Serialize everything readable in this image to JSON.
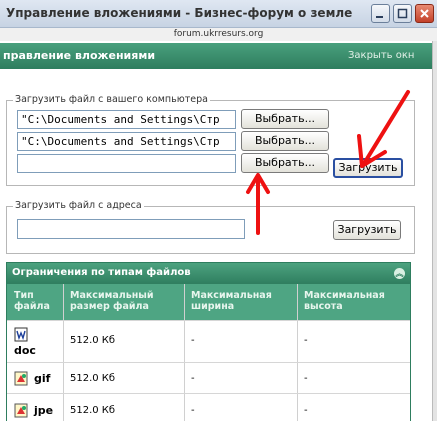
{
  "window": {
    "title": "Управление вложениями - Бизнес-форум о земле",
    "url": "forum.ukrresurs.org"
  },
  "header": {
    "title": "правление вложениями",
    "close_label": "Закрыть окн"
  },
  "upload_local": {
    "legend": "Загрузить файл с вашего компьютера",
    "files": [
      {
        "path": "\"C:\\Documents and Settings\\Стр"
      },
      {
        "path": "\"C:\\Documents and Settings\\Стр"
      },
      {
        "path": ""
      }
    ],
    "browse_label": "Выбрать...",
    "upload_label": "Загрузить"
  },
  "upload_url": {
    "legend": "Загрузить файл с адреса",
    "value": "",
    "upload_label": "Загрузить"
  },
  "limits": {
    "title": "Ограничения по типам файлов",
    "columns": [
      "Тип\nфайла",
      "Максимальный\nразмер файла",
      "Максимальная\nширина",
      "Максимальная\nвысота"
    ],
    "rows": [
      {
        "type": "doc",
        "size": "512.0 Кб",
        "width": "-",
        "height": "-",
        "icon": "word-document-icon"
      },
      {
        "type": "gif",
        "size": "512.0 Кб",
        "width": "-",
        "height": "-",
        "icon": "image-file-icon"
      },
      {
        "type": "jpe",
        "size": "512.0 Кб",
        "width": "-",
        "height": "-",
        "icon": "image-file-icon"
      }
    ]
  },
  "colors": {
    "header_green": "#2e7d5e",
    "table_head_green": "#4ea583",
    "annotation_arrow": "#ee1111",
    "upload_button_border": "#2a4fa1"
  }
}
